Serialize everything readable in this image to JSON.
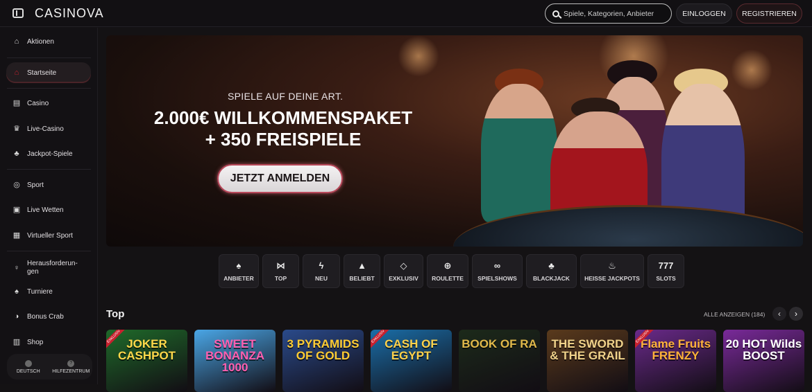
{
  "header": {
    "logo": "CASINOVA",
    "search_placeholder": "Spiele, Kategorien, Anbieter",
    "login_label": "EINLOGGEN",
    "register_label": "REGISTRIEREN"
  },
  "sidebar": {
    "items": [
      {
        "label": "Aktionen",
        "icon": "gift-icon",
        "glyph": "⌂"
      },
      {
        "label": "Startseite",
        "icon": "home-icon",
        "glyph": "⌂"
      },
      {
        "label": "Casino",
        "icon": "slot-machine-icon",
        "glyph": "▤"
      },
      {
        "label": "Live-Casino",
        "icon": "live-dealer-icon",
        "glyph": "♛"
      },
      {
        "label": "Jackpot-Spiele",
        "icon": "clover-icon",
        "glyph": "♣"
      },
      {
        "label": "Sport",
        "icon": "soccer-ball-icon",
        "glyph": "◎"
      },
      {
        "label": "Live Wetten",
        "icon": "live-bet-icon",
        "glyph": "▣"
      },
      {
        "label": "Virtueller Sport",
        "icon": "virtual-sport-icon",
        "glyph": "▦"
      },
      {
        "label": "Herausforderun-gen",
        "icon": "challenge-icon",
        "glyph": "♀"
      },
      {
        "label": "Turniere",
        "icon": "trophy-icon",
        "glyph": "♠"
      },
      {
        "label": "Bonus Crab",
        "icon": "bonus-crab-icon",
        "glyph": "◑"
      },
      {
        "label": "Shop",
        "icon": "shop-icon",
        "glyph": "▥"
      }
    ],
    "language_label": "DEUTSCH",
    "help_label": "HILFEZENTRUM"
  },
  "hero": {
    "subtitle": "SPIELE AUF DEINE ART.",
    "title_line1": "2.000€ WILLKOMMENSPAKET",
    "title_line2": "+ 350 FREISPIELE",
    "cta_label": "JETZT ANMELDEN"
  },
  "categories": [
    {
      "label": "ANBIETER",
      "icon": "provider-icon",
      "glyph": "♠"
    },
    {
      "label": "TOP",
      "icon": "bow-tie-icon",
      "glyph": "⋈"
    },
    {
      "label": "NEU",
      "icon": "lightning-icon",
      "glyph": "ϟ"
    },
    {
      "label": "BELIEBT",
      "icon": "flame-icon",
      "glyph": "▲"
    },
    {
      "label": "EXKLUSIV",
      "icon": "diamond-icon",
      "glyph": "◇"
    },
    {
      "label": "ROULETTE",
      "icon": "roulette-icon",
      "glyph": "⊕"
    },
    {
      "label": "SPIELSHOWS",
      "icon": "mask-icon",
      "glyph": "∞"
    },
    {
      "label": "BLACKJACK",
      "icon": "cards-icon",
      "glyph": "♣"
    },
    {
      "label": "HEISSE JACKPOTS",
      "icon": "hot-jackpot-icon",
      "glyph": "♨"
    },
    {
      "label": "SLOTS",
      "icon": "slots-777-icon",
      "glyph": "777"
    }
  ],
  "top_section": {
    "title": "Top",
    "show_all": "ALLE ANZEIGEN (184)"
  },
  "games": [
    {
      "title": "JOKER CASHPOT",
      "exclusive": "EXKLUSIV",
      "bg": "#1f6a2a",
      "color": "#ffd84a"
    },
    {
      "title": "SWEET BONANZA 1000",
      "exclusive": "",
      "bg": "#4aa6e6",
      "color": "#ff5fb0"
    },
    {
      "title": "3 PYRAMIDS OF GOLD",
      "exclusive": "",
      "bg": "#2a4a8a",
      "color": "#ffcc33"
    },
    {
      "title": "CASH OF EGYPT",
      "exclusive": "EXKLUSIV",
      "bg": "#1a6ea8",
      "color": "#ffd24a"
    },
    {
      "title": "BOOK OF RA",
      "exclusive": "",
      "bg": "#1c2a1a",
      "color": "#e0b84a"
    },
    {
      "title": "THE SWORD & THE GRAIL",
      "exclusive": "",
      "bg": "#5a3a1c",
      "color": "#f0d28a"
    },
    {
      "title": "Flame Fruits FRENZY",
      "exclusive": "EXKLUSIV",
      "bg": "#6a2a8a",
      "color": "#ffb23a"
    },
    {
      "title": "20 HOT Wilds BOOST",
      "exclusive": "",
      "bg": "#7a2a9a",
      "color": "#ffffff"
    }
  ]
}
